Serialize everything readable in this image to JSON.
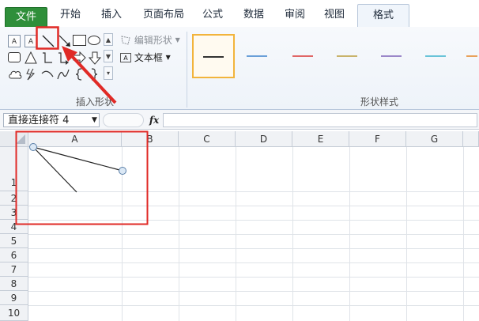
{
  "tabs": {
    "file": "文件",
    "items": [
      "开始",
      "插入",
      "页面布局",
      "公式",
      "数据",
      "审阅",
      "视图"
    ],
    "active": "格式"
  },
  "ribbon": {
    "insert_shapes": {
      "group_label": "插入形状",
      "edit_shape": "编辑形状",
      "text_box": "文本框",
      "gallery_labels": [
        "A",
        "A"
      ]
    },
    "shape_styles": {
      "group_label": "形状样式",
      "style_colors": [
        "#333333",
        "#6a9fd8",
        "#e06666",
        "#c9b36b",
        "#9b87c9",
        "#69c3d8",
        "#e8a15a"
      ]
    }
  },
  "formula_bar": {
    "name_box": "直接连接符 4",
    "fx": "fx"
  },
  "sheet": {
    "columns": [
      "A",
      "B",
      "C",
      "D",
      "E",
      "F",
      "G"
    ],
    "rows": [
      "1",
      "2",
      "3",
      "4",
      "5",
      "6",
      "7",
      "8",
      "9",
      "10"
    ]
  },
  "colors": {
    "file_tab": "#2f8f3a",
    "annotation": "#e02a26"
  }
}
